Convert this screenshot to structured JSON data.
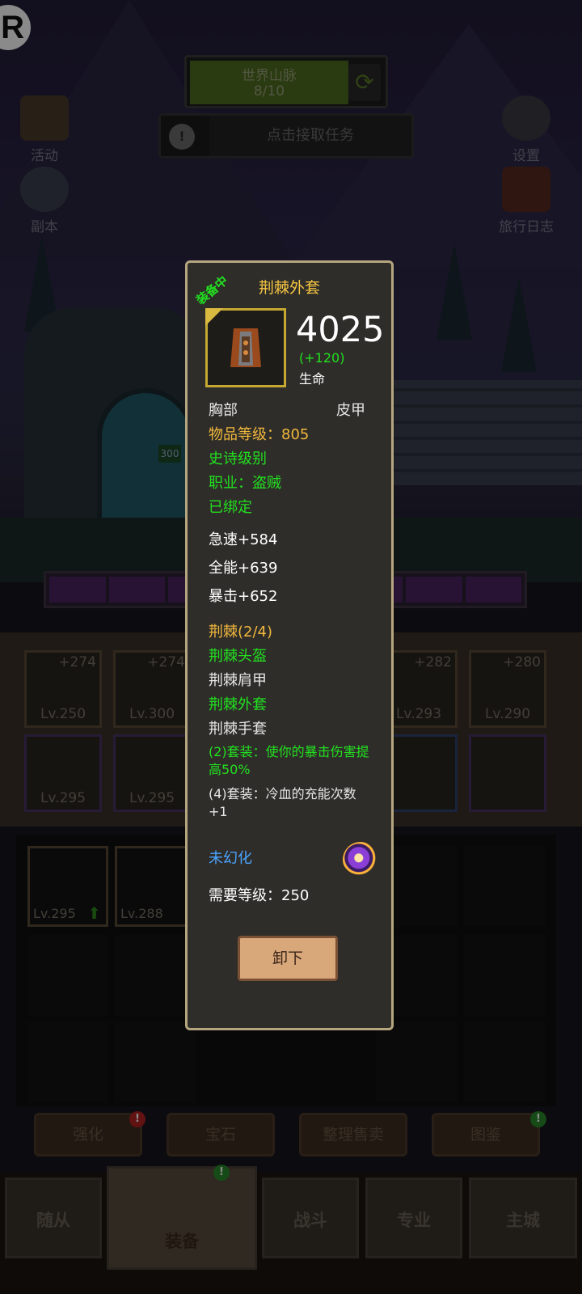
{
  "hud": {
    "map_name": "世界山脉",
    "map_progress": "8/10",
    "task_prompt": "点击接取任务",
    "left_buttons": [
      "活动",
      "副本"
    ],
    "right_buttons": [
      "设置",
      "旅行日志"
    ],
    "marker_value": "300"
  },
  "equipped_slots": [
    {
      "plus": "+274",
      "level": "Lv.250"
    },
    {
      "plus": "+274",
      "level": "Lv.300"
    },
    {
      "plus": "+282",
      "level": "Lv.293"
    },
    {
      "plus": "+280",
      "level": "Lv.290"
    },
    {
      "plus": "",
      "level": "Lv.295"
    },
    {
      "plus": "",
      "level": "Lv.295"
    }
  ],
  "bag_items": [
    {
      "level": "Lv.295"
    },
    {
      "level": "Lv.288"
    }
  ],
  "function_buttons": [
    "强化",
    "宝石",
    "整理售卖",
    "图鉴"
  ],
  "bottom_nav": [
    "随从",
    "装备",
    "战斗",
    "专业",
    "主城"
  ],
  "tooltip": {
    "ribbon": "装备中",
    "item_name": "荆棘外套",
    "power_value": "4025",
    "power_delta": "(+120)",
    "power_stat": "生命",
    "slot": "胸部",
    "armor_type": "皮甲",
    "item_level": "物品等级：805",
    "rarity": "史诗级别",
    "class_req": "职业：盗贼",
    "bound": "已绑定",
    "stats": [
      "急速+584",
      "全能+639",
      "暴击+652"
    ],
    "set_name": "荆棘(2/4)",
    "set_pieces": [
      {
        "name": "荆棘头盔",
        "owned": true
      },
      {
        "name": "荆棘肩甲",
        "owned": false
      },
      {
        "name": "荆棘外套",
        "owned": true
      },
      {
        "name": "荆棘手套",
        "owned": false
      }
    ],
    "set_bonus_2": "(2)套装：使你的暴击伤害提高50%",
    "set_bonus_4": "(4)套装：冷血的充能次数+1",
    "transmog": "未幻化",
    "required_level": "需要等级：250",
    "unequip_label": "卸下"
  },
  "colors": {
    "epic_green": "#22e020",
    "gold": "#f0b73d",
    "panel_border": "#b5a67f",
    "transmog_blue": "#4aa3ff"
  }
}
